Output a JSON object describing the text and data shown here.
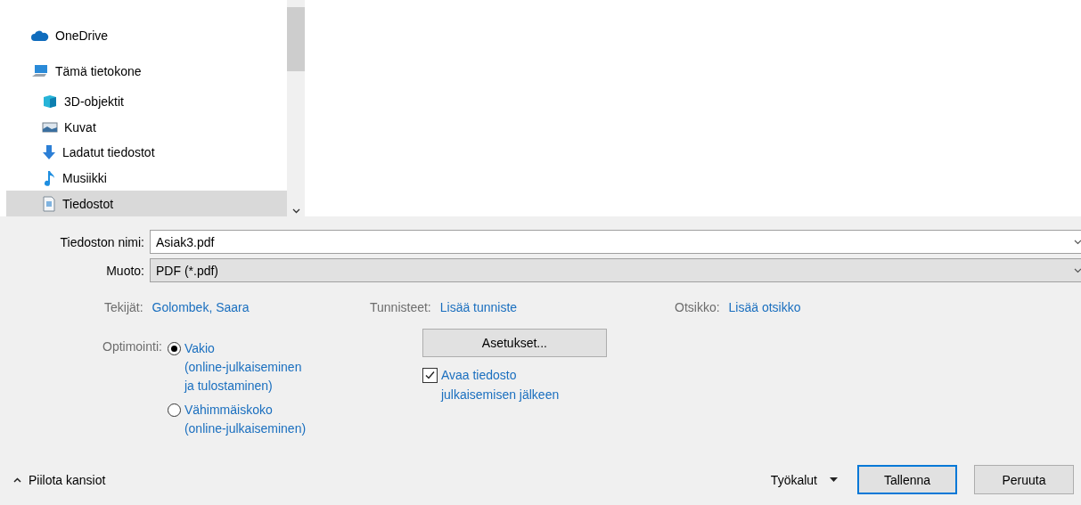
{
  "sidebar": {
    "items": [
      {
        "label": "OneDrive",
        "kind": "cloud",
        "selected": false
      },
      {
        "label": "Tämä tietokone",
        "kind": "computer",
        "selected": false,
        "children": [
          {
            "label": "3D-objektit",
            "kind": "cube",
            "selected": false
          },
          {
            "label": "Kuvat",
            "kind": "pictures",
            "selected": false
          },
          {
            "label": "Ladatut tiedostot",
            "kind": "download",
            "selected": false
          },
          {
            "label": "Musiikki",
            "kind": "music",
            "selected": false
          },
          {
            "label": "Tiedostot",
            "kind": "document",
            "selected": true
          }
        ]
      }
    ]
  },
  "filename": {
    "label": "Tiedoston nimi:",
    "value": "Asiak3.pdf"
  },
  "format": {
    "label": "Muoto:",
    "value": "PDF (*.pdf)"
  },
  "metadata": [
    {
      "label": "Tekijät:",
      "value": "Golombek, Saara"
    },
    {
      "label": "Tunnisteet:",
      "value": "Lisää tunniste"
    },
    {
      "label": "Otsikko:",
      "value": "Lisää otsikko"
    }
  ],
  "optimization": {
    "label": "Optimointi:",
    "options": [
      {
        "lines": [
          "Vakio",
          "(online-julkaiseminen",
          "ja tulostaminen)"
        ],
        "selected": true
      },
      {
        "lines": [
          "Vähimmäiskoko",
          "(online-julkaiseminen)"
        ],
        "selected": false
      }
    ]
  },
  "settings_button": "Asetukset...",
  "open_after": {
    "lines": [
      "Avaa tiedosto",
      "julkaisemisen jälkeen"
    ],
    "checked": true
  },
  "footer": {
    "hide_folders": "Piilota kansiot",
    "tools": "Työkalut",
    "buttons": [
      {
        "label": "Tallenna",
        "kind": "primary"
      },
      {
        "label": "Peruuta",
        "kind": "secondary"
      }
    ]
  }
}
